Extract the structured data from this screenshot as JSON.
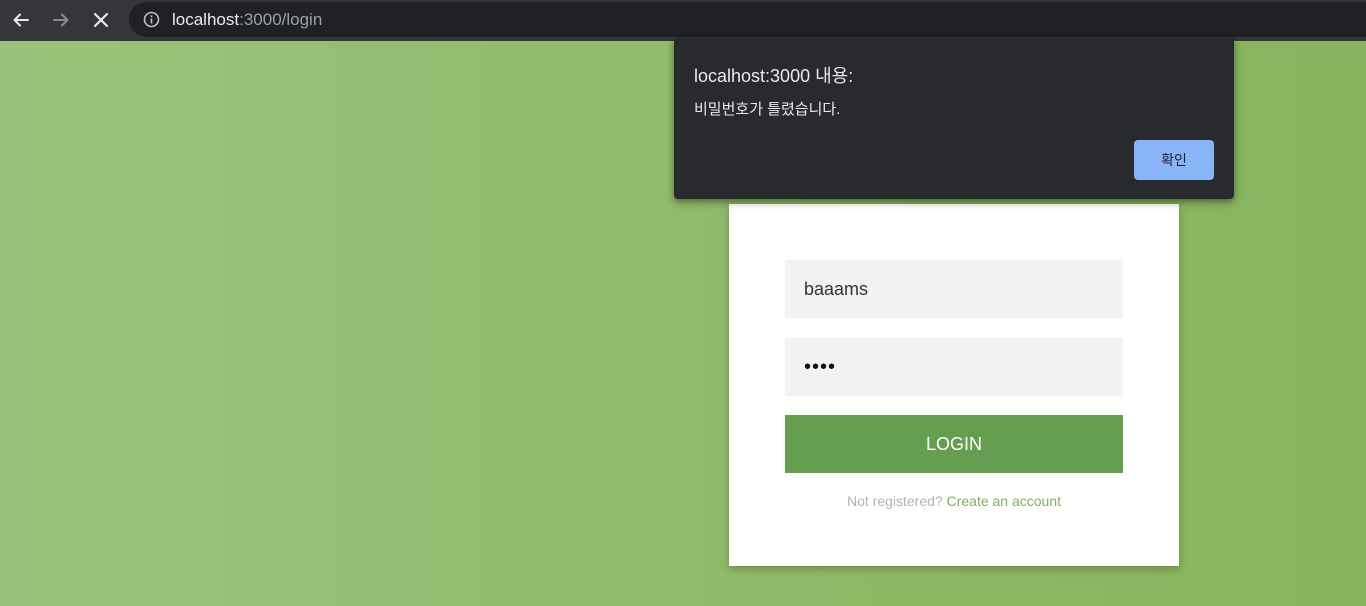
{
  "browser": {
    "icons": {
      "back": "arrow-left-icon",
      "forward": "arrow-right-icon",
      "stop": "close-icon",
      "site_info": "info-icon"
    },
    "url_host": "localhost",
    "url_rest": ":3000/login"
  },
  "dialog": {
    "title": "localhost:3000 내용:",
    "message": "비밀번호가 틀렸습니다.",
    "ok_label": "확인"
  },
  "login": {
    "username_value": "baaams",
    "password_masked": "••••",
    "login_label": "LOGIN",
    "register_prefix": "Not registered?",
    "register_link": "Create an account"
  },
  "colors": {
    "background_green": "#8ab862",
    "login_button": "#659d51",
    "dialog_background": "#292a2d",
    "dialog_button": "#8ab4f8"
  }
}
